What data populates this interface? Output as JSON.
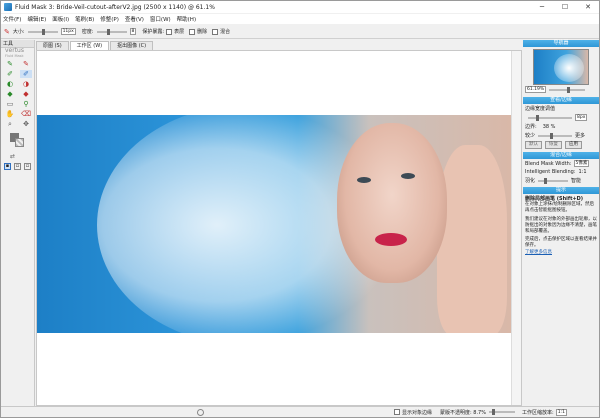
{
  "window": {
    "title": "Fluid Mask 3: Bride-Veil-cutout-afterV2.jpg (2500 x 1140) @ 61.1%",
    "controls": [
      "─",
      "☐",
      "✕"
    ]
  },
  "menu": [
    "文件(F)",
    "编辑(E)",
    "面板(I)",
    "笔刷(B)",
    "修整(P)",
    "查看(V)",
    "窗口(W)",
    "帮助(H)"
  ],
  "toolbar": {
    "size_label": "大小:",
    "size_value": "11px",
    "density_label": "密度:",
    "density_value": "8",
    "protect_label": "保护暴露:",
    "option1": "表层",
    "option2": "删除",
    "option3": "混合"
  },
  "tools": {
    "header": "工具",
    "brand": "vertus",
    "brand_sub": "Fluid Mask"
  },
  "tabs": [
    "原图 (S)",
    "工作区 (W)",
    "抠出图像 (C)"
  ],
  "active_tab": 1,
  "panels": {
    "navigator": {
      "title": "导航器",
      "zoom": "61.19%"
    },
    "edge": {
      "title": "查看/边缘",
      "subtitle": "边缘宽度调值",
      "width_value": "8px",
      "contrast_label": "边界:",
      "contrast_value": "38 %",
      "less_label": "较少",
      "more_label": "更多",
      "buttons": [
        "默认",
        "恢复",
        "应用"
      ]
    },
    "blend": {
      "title": "混合/边缘",
      "blend_mask_label": "Blend Mask Width:",
      "blend_mask_value": "5像素",
      "intelligent_label": "Intelligent Blending:",
      "intelligent_value": "1:1",
      "smooth_label": "羽化",
      "smooth_right": "智能"
    },
    "help": {
      "title": "提示",
      "heading": "删除局部画笔 (Shift+D)",
      "p1": "在对象上涂抹/绘制删除区域，然后再点击智能抠图按钮。",
      "p2": "我们建议在对象的外部画出轮廓，以防抠出的对象因为边缘不清楚，画笔和局部覆盖。",
      "p3": "完成后，点击保护区域以查看结果并保存。",
      "link": "了解更多信息"
    }
  },
  "status": {
    "show_edge_label": "显示对象边缘",
    "opacity_label": "蒙版不透明度: 8.7%",
    "zoom_label": "工作区缩放率:",
    "zoom_value": "1:1"
  },
  "colors": {
    "accent": "#2f97d6",
    "link": "#1a5fb4"
  }
}
